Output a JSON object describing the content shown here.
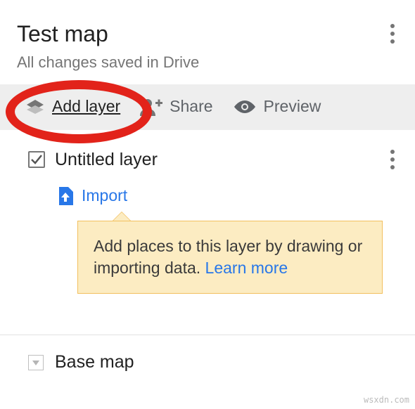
{
  "header": {
    "title": "Test map",
    "status": "All changes saved in Drive"
  },
  "toolbar": {
    "add_layer_label": "Add layer",
    "share_label": "Share",
    "preview_label": "Preview"
  },
  "layer": {
    "checked": true,
    "name": "Untitled layer",
    "import_label": "Import"
  },
  "tooltip": {
    "text": "Add places to this layer by drawing or importing data. ",
    "link_label": "Learn more"
  },
  "base": {
    "label": "Base map"
  },
  "meta": {
    "watermark": "wsxdn.com"
  },
  "colors": {
    "link_blue": "#2877e8",
    "highlight_red": "#e2231a",
    "tooltip_bg": "#fcecc2",
    "tooltip_border": "#f2bf5e"
  }
}
